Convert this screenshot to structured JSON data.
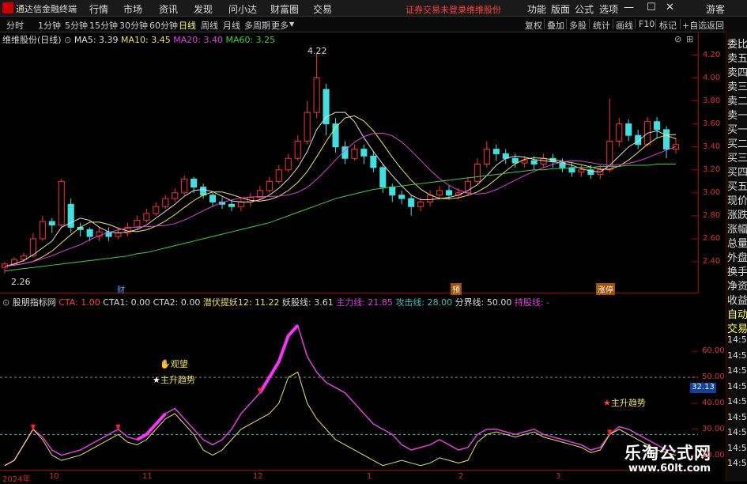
{
  "menubar": {
    "app_name": "通达信金融终端",
    "items": [
      "行情",
      "市场",
      "资讯",
      "发现",
      "问小达",
      "财富圈",
      "交易"
    ],
    "notice": "证券交易未登录",
    "notice_stock": "维维股份",
    "right_items": [
      "功能",
      "版面",
      "公式",
      "选项"
    ],
    "guest": "游客"
  },
  "toolbar": {
    "periods": [
      "分时",
      "1分钟",
      "5分钟",
      "15分钟",
      "30分钟",
      "60分钟",
      "日线",
      "周线",
      "月线",
      "多周期",
      "更多"
    ],
    "active": "日线",
    "right_items": [
      "复权",
      "叠加",
      "多股",
      "统计",
      "画线",
      "F10",
      "标记",
      "+自选",
      "返回"
    ]
  },
  "main_legend": {
    "title": "维维股份(日线)",
    "ma5": "MA5: 3.39",
    "ma10": "MA10: 3.45",
    "ma20": "MA20: 3.40",
    "ma60": "MA60: 3.25",
    "high_label": "4.22",
    "low_label": "2.26"
  },
  "sub_legend": {
    "title": "股朋指标网",
    "cta": "CTA: 1.00",
    "cta1": "CTA1: 0.00",
    "cta2": "CTA2: 0.00",
    "qfty": "潜伏提妖12: 11.22",
    "yg": "妖股线: 3.61",
    "zl": "主力线: 21.85",
    "gj": "攻击线: 28.00",
    "fj": "分界线: 50.00",
    "cg": "持股线: -"
  },
  "annotations": {
    "watch": "观望",
    "uptrend": "主升趋势",
    "uptrend2": "主升趋势",
    "cai1": "财",
    "cai2": "预",
    "cai3": "涨停"
  },
  "right_panel": [
    "委比",
    "卖五",
    "卖四",
    "卖三",
    "卖二",
    "卖一",
    "买一",
    "买二",
    "买三",
    "买四",
    "买五",
    "现价",
    "涨跌",
    "涨幅",
    "总量",
    "外盘",
    "换手",
    "净资",
    "收益",
    "自动",
    "交易"
  ],
  "time_labels": [
    "14:5",
    "14:5",
    "14:5",
    "14:5",
    "14:5",
    "14:5",
    "14:5",
    "14:5",
    "14:5"
  ],
  "value_box": "32.13",
  "watermark": {
    "cn": "乐淘公式网",
    "url": "www.60lt.com"
  },
  "x_labels": [
    "2024年",
    "10",
    "11",
    "12",
    "1",
    "2",
    "3"
  ],
  "chart_data": [
    {
      "type": "line",
      "title": "维维股份(日线)",
      "ylim": [
        2.2,
        4.3
      ],
      "yticks": [
        4.2,
        4.0,
        3.8,
        3.6,
        3.4,
        3.2,
        3.0,
        2.8,
        2.6,
        2.4
      ],
      "candles": [
        [
          2.35,
          2.38,
          2.3,
          2.4
        ],
        [
          2.38,
          2.42,
          2.36,
          2.44
        ],
        [
          2.42,
          2.45,
          2.4,
          2.48
        ],
        [
          2.45,
          2.6,
          2.44,
          2.65
        ],
        [
          2.6,
          2.75,
          2.58,
          2.8
        ],
        [
          2.75,
          2.72,
          2.65,
          2.78
        ],
        [
          2.72,
          3.1,
          2.7,
          3.12
        ],
        [
          2.9,
          2.7,
          2.65,
          2.95
        ],
        [
          2.7,
          2.68,
          2.62,
          2.74
        ],
        [
          2.68,
          2.62,
          2.58,
          2.7
        ],
        [
          2.62,
          2.66,
          2.58,
          2.7
        ],
        [
          2.66,
          2.62,
          2.58,
          2.7
        ],
        [
          2.62,
          2.65,
          2.6,
          2.7
        ],
        [
          2.65,
          2.7,
          2.62,
          2.74
        ],
        [
          2.7,
          2.76,
          2.68,
          2.8
        ],
        [
          2.76,
          2.82,
          2.74,
          2.86
        ],
        [
          2.82,
          2.88,
          2.8,
          2.92
        ],
        [
          2.88,
          2.95,
          2.86,
          2.98
        ],
        [
          2.95,
          3.0,
          2.92,
          3.04
        ],
        [
          3.0,
          3.12,
          2.98,
          3.15
        ],
        [
          3.12,
          3.05,
          3.0,
          3.14
        ],
        [
          3.05,
          2.98,
          2.95,
          3.08
        ],
        [
          2.98,
          2.92,
          2.88,
          3.0
        ],
        [
          2.92,
          2.9,
          2.86,
          2.96
        ],
        [
          2.9,
          2.88,
          2.84,
          2.94
        ],
        [
          2.88,
          2.92,
          2.84,
          2.96
        ],
        [
          2.92,
          2.96,
          2.88,
          3.0
        ],
        [
          2.96,
          3.02,
          2.94,
          3.06
        ],
        [
          3.02,
          3.1,
          3.0,
          3.14
        ],
        [
          3.1,
          3.2,
          3.08,
          3.24
        ],
        [
          3.2,
          3.3,
          3.18,
          3.34
        ],
        [
          3.3,
          3.45,
          3.28,
          3.5
        ],
        [
          3.45,
          3.7,
          3.42,
          3.8
        ],
        [
          3.7,
          4.0,
          3.65,
          4.22
        ],
        [
          3.9,
          3.6,
          3.5,
          3.95
        ],
        [
          3.6,
          3.4,
          3.35,
          3.65
        ],
        [
          3.4,
          3.3,
          3.25,
          3.45
        ],
        [
          3.3,
          3.38,
          3.28,
          3.42
        ],
        [
          3.38,
          3.32,
          3.25,
          3.42
        ],
        [
          3.32,
          3.22,
          3.18,
          3.36
        ],
        [
          3.22,
          3.05,
          3.0,
          3.25
        ],
        [
          3.05,
          2.98,
          2.92,
          3.08
        ],
        [
          2.98,
          2.95,
          2.9,
          3.02
        ],
        [
          2.95,
          2.88,
          2.8,
          2.98
        ],
        [
          2.88,
          2.92,
          2.84,
          2.96
        ],
        [
          2.92,
          2.98,
          2.88,
          3.02
        ],
        [
          2.98,
          3.02,
          2.94,
          3.06
        ],
        [
          3.02,
          2.98,
          2.94,
          3.06
        ],
        [
          2.98,
          3.0,
          2.94,
          3.04
        ],
        [
          3.0,
          3.1,
          2.98,
          3.14
        ],
        [
          3.1,
          3.25,
          3.08,
          3.3
        ],
        [
          3.25,
          3.38,
          3.22,
          3.45
        ],
        [
          3.38,
          3.34,
          3.28,
          3.42
        ],
        [
          3.34,
          3.3,
          3.25,
          3.38
        ],
        [
          3.3,
          3.26,
          3.22,
          3.34
        ],
        [
          3.26,
          3.28,
          3.22,
          3.32
        ],
        [
          3.28,
          3.25,
          3.2,
          3.32
        ],
        [
          3.25,
          3.3,
          3.22,
          3.34
        ],
        [
          3.3,
          3.27,
          3.22,
          3.34
        ],
        [
          3.27,
          3.22,
          3.18,
          3.3
        ],
        [
          3.22,
          3.18,
          3.14,
          3.26
        ],
        [
          3.18,
          3.2,
          3.14,
          3.24
        ],
        [
          3.2,
          3.16,
          3.12,
          3.24
        ],
        [
          3.16,
          3.2,
          3.12,
          3.24
        ],
        [
          3.2,
          3.45,
          3.18,
          3.82
        ],
        [
          3.45,
          3.6,
          3.4,
          3.65
        ],
        [
          3.6,
          3.5,
          3.45,
          3.64
        ],
        [
          3.5,
          3.42,
          3.38,
          3.55
        ],
        [
          3.42,
          3.62,
          3.4,
          3.66
        ],
        [
          3.62,
          3.55,
          3.48,
          3.66
        ],
        [
          3.55,
          3.38,
          3.3,
          3.58
        ],
        [
          3.38,
          3.42,
          3.34,
          3.48
        ]
      ],
      "ma5": [
        2.36,
        2.38,
        2.41,
        2.46,
        2.52,
        2.58,
        2.7,
        2.74,
        2.78,
        2.76,
        2.7,
        2.66,
        2.65,
        2.66,
        2.68,
        2.72,
        2.78,
        2.84,
        2.9,
        2.97,
        3.02,
        3.03,
        3.01,
        2.97,
        2.93,
        2.92,
        2.92,
        2.94,
        2.98,
        3.04,
        3.12,
        3.22,
        3.36,
        3.55,
        3.66,
        3.7,
        3.7,
        3.62,
        3.48,
        3.36,
        3.25,
        3.15,
        3.06,
        2.98,
        2.94,
        2.94,
        2.95,
        2.96,
        2.98,
        3.02,
        3.07,
        3.15,
        3.24,
        3.3,
        3.32,
        3.31,
        3.29,
        3.28,
        3.27,
        3.26,
        3.24,
        3.21,
        3.19,
        3.18,
        3.24,
        3.32,
        3.4,
        3.45,
        3.52,
        3.54,
        3.5,
        3.47
      ],
      "ma60": [
        2.32,
        2.33,
        2.34,
        2.35,
        2.36,
        2.37,
        2.38,
        2.39,
        2.4,
        2.41,
        2.42,
        2.43,
        2.44,
        2.45,
        2.47,
        2.48,
        2.5,
        2.52,
        2.54,
        2.56,
        2.58,
        2.6,
        2.62,
        2.64,
        2.66,
        2.68,
        2.7,
        2.72,
        2.74,
        2.77,
        2.8,
        2.83,
        2.86,
        2.89,
        2.92,
        2.95,
        2.97,
        2.99,
        3.01,
        3.03,
        3.04,
        3.05,
        3.06,
        3.07,
        3.08,
        3.09,
        3.1,
        3.11,
        3.12,
        3.13,
        3.14,
        3.15,
        3.16,
        3.17,
        3.18,
        3.19,
        3.2,
        3.2,
        3.21,
        3.21,
        3.22,
        3.22,
        3.22,
        3.23,
        3.23,
        3.23,
        3.24,
        3.24,
        3.24,
        3.25,
        3.25,
        3.25
      ]
    },
    {
      "type": "line",
      "title": "股朋指标网",
      "ylim": [
        15,
        75
      ],
      "yticks": [
        60,
        50,
        40,
        30,
        20
      ],
      "series": [
        {
          "name": "主力线",
          "values": [
            16,
            18,
            24,
            30,
            27,
            22,
            20,
            21,
            22,
            24,
            26,
            28,
            30,
            27,
            26,
            28,
            32,
            36,
            38,
            34,
            30,
            26,
            24,
            26,
            30,
            36,
            40,
            44,
            50,
            56,
            66,
            70,
            58,
            52,
            48,
            46,
            44,
            40,
            36,
            32,
            30,
            28,
            24,
            22,
            23,
            24,
            26,
            24,
            22,
            23,
            28,
            30,
            30,
            29,
            28,
            29,
            30,
            28,
            27,
            26,
            25,
            24,
            22,
            23,
            28,
            31,
            30,
            28,
            26,
            24,
            22,
            21.85
          ]
        },
        {
          "name": "攻击线",
          "values": [
            16,
            18,
            24,
            30,
            26,
            20,
            18,
            19,
            20,
            22,
            24,
            26,
            28,
            25,
            24,
            26,
            30,
            34,
            36,
            32,
            28,
            22,
            20,
            22,
            26,
            30,
            32,
            34,
            36,
            40,
            50,
            52,
            40,
            34,
            30,
            26,
            24,
            22,
            20,
            18,
            16,
            17,
            18,
            17,
            16,
            17,
            19,
            18,
            17,
            18,
            25,
            28,
            29,
            28,
            27,
            28,
            29,
            27,
            26,
            25,
            24,
            23,
            21,
            22,
            28,
            30,
            28,
            26,
            24,
            22,
            21,
            20
          ]
        }
      ]
    }
  ]
}
